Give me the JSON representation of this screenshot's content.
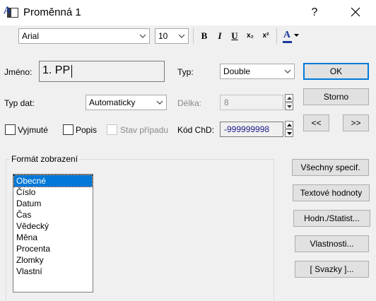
{
  "window": {
    "title": "Proměnná 1",
    "help_label": "?",
    "icons": {
      "app": "window-icon",
      "close": "close-icon"
    }
  },
  "toolbar": {
    "font_icon_label": "A",
    "font_name": "Arial",
    "font_size": "10",
    "bold_label": "B",
    "italic_label": "I",
    "underline_label": "U",
    "subscript_label": "x₂",
    "superscript_label": "x²",
    "color_label": "A",
    "accent_color": "#1a3a9a"
  },
  "form": {
    "name_label": "Jméno:",
    "name_value": "1. PP",
    "type_label": "Typ:",
    "type_value": "Double",
    "datatype_label": "Typ dat:",
    "datatype_value": "Automaticky",
    "length_label": "Délka:",
    "length_value": "8",
    "missing_code_label": "Kód ChD:",
    "missing_code_value": "-999999998",
    "check_excluded": {
      "label": "Vyjmuté",
      "checked": false
    },
    "check_labels": {
      "label": "Popis",
      "checked": false
    },
    "check_state": {
      "label": "Stav případu",
      "checked": false,
      "disabled": true
    }
  },
  "buttons": {
    "ok": "OK",
    "cancel": "Storno",
    "prev": "<<",
    "next": ">>",
    "all_specs": "Všechny specif.",
    "text_values": "Textové hodnoty",
    "values_stats": "Hodn./Statist...",
    "properties": "Vlastnosti...",
    "links": "[ Svazky ]..."
  },
  "format_group": {
    "title": "Formát zobrazení",
    "items": [
      "Obecné",
      "Číslo",
      "Datum",
      "Čas",
      "Vědecký",
      "Měna",
      "Procenta",
      "Zlomky",
      "Vlastní"
    ],
    "selected_index": 0,
    "selection_color": "#0078d7"
  }
}
